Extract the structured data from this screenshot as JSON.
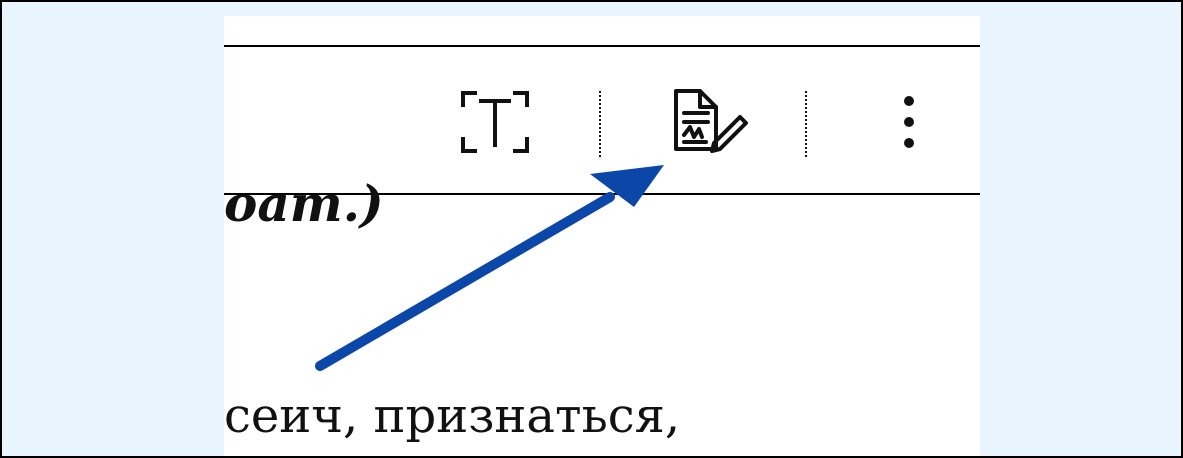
{
  "toolbar": {
    "icons": [
      "text-recognition-icon",
      "sign-document-icon",
      "more-vertical-icon"
    ]
  },
  "document": {
    "fragment_above": "oam.)",
    "visible_line": "сеич,  признаться,"
  },
  "annotation": {
    "arrow_color": "#0b47a8"
  },
  "colors": {
    "frame_background": "#e8f4fe",
    "content_background": "#ffffff",
    "border": "#000000"
  }
}
